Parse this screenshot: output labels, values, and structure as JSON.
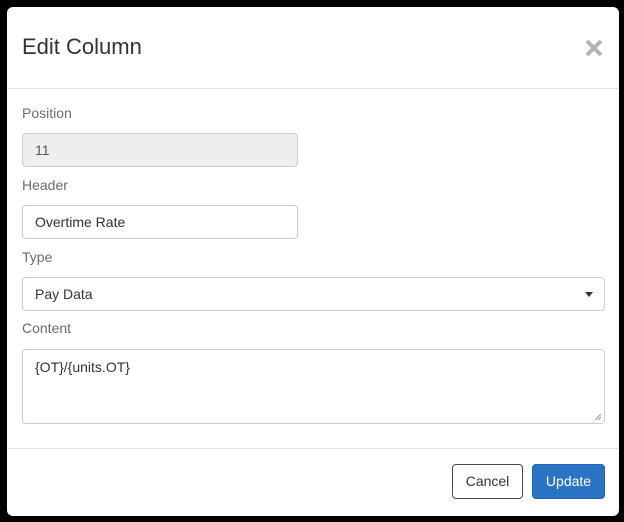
{
  "dialog": {
    "title": "Edit Column",
    "close_icon": "close-icon"
  },
  "fields": {
    "position": {
      "label": "Position",
      "value": "11",
      "disabled": true
    },
    "header": {
      "label": "Header",
      "value": "Overtime Rate"
    },
    "type": {
      "label": "Type",
      "selected": "Pay Data",
      "icon": "chevron-down-icon"
    },
    "content": {
      "label": "Content",
      "value": "{OT}/{units.OT}"
    }
  },
  "footer": {
    "cancel_label": "Cancel",
    "update_label": "Update"
  },
  "colors": {
    "primary": "#2a73c5",
    "disabled_bg": "#eeeeee",
    "border": "#cccccc"
  }
}
